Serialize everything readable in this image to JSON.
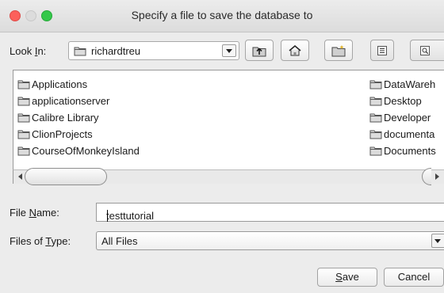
{
  "window": {
    "title": "Specify a file to save the database to"
  },
  "look_in": {
    "label_pre": "Look ",
    "label_u": "I",
    "label_post": "n:",
    "value": "richardtreu"
  },
  "toolbar": {
    "up_icon": "folder-up-icon",
    "home_icon": "home-icon",
    "new_folder_icon": "new-folder-icon",
    "list_view_icon": "list-view-icon",
    "details_view_icon": "details-view-icon"
  },
  "files": {
    "col1": [
      "Applications",
      "applicationserver",
      "Calibre Library",
      "ClionProjects",
      "CourseOfMonkeyIsland"
    ],
    "col2": [
      "DataWareh",
      "Desktop",
      "Developer",
      "documenta",
      "Documents"
    ]
  },
  "file_name": {
    "label_pre": "File ",
    "label_u": "N",
    "label_post": "ame:",
    "value": "testtutorial"
  },
  "file_type": {
    "label_pre": "Files of ",
    "label_u": "T",
    "label_post": "ype:",
    "value": "All Files"
  },
  "buttons": {
    "save_u": "S",
    "save_rest": "ave",
    "cancel": "Cancel"
  }
}
